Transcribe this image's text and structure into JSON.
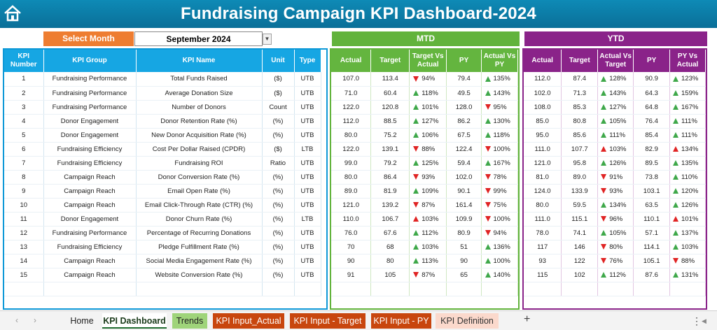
{
  "title": "Fundraising Campaign KPI Dashboard-2024",
  "select_month_label": "Select Month",
  "select_month_value": "September 2024",
  "mtd_label": "MTD",
  "ytd_label": "YTD",
  "kpi_headers": [
    "KPI Number",
    "KPI Group",
    "KPI Name",
    "Unit",
    "Type"
  ],
  "mtd_headers": [
    "Actual",
    "Target",
    "Target Vs Actual",
    "PY",
    "Actual Vs PY"
  ],
  "ytd_headers": [
    "Actual",
    "Target",
    "Actual Vs Target",
    "PY",
    "PY Vs Actual"
  ],
  "rows": [
    {
      "num": "1",
      "group": "Fundraising Performance",
      "name": "Total Funds Raised",
      "unit": "($)",
      "type": "UTB",
      "mtd": [
        "107.0",
        "113.4",
        "94%",
        "79.4",
        "135%"
      ],
      "mtd_ind": [
        "down",
        "up"
      ],
      "ytd": [
        "112.0",
        "87.4",
        "128%",
        "90.9",
        "123%"
      ],
      "ytd_ind": [
        "up",
        "up"
      ]
    },
    {
      "num": "2",
      "group": "Fundraising Performance",
      "name": "Average Donation Size",
      "unit": "($)",
      "type": "UTB",
      "mtd": [
        "71.0",
        "60.4",
        "118%",
        "49.5",
        "143%"
      ],
      "mtd_ind": [
        "up",
        "up"
      ],
      "ytd": [
        "102.0",
        "71.3",
        "143%",
        "64.3",
        "159%"
      ],
      "ytd_ind": [
        "up",
        "up"
      ]
    },
    {
      "num": "3",
      "group": "Fundraising Performance",
      "name": "Number of Donors",
      "unit": "Count",
      "type": "UTB",
      "mtd": [
        "122.0",
        "120.8",
        "101%",
        "128.0",
        "95%"
      ],
      "mtd_ind": [
        "up",
        "down"
      ],
      "ytd": [
        "108.0",
        "85.3",
        "127%",
        "64.8",
        "167%"
      ],
      "ytd_ind": [
        "up",
        "up"
      ]
    },
    {
      "num": "4",
      "group": "Donor Engagement",
      "name": "Donor Retention Rate (%)",
      "unit": "(%)",
      "type": "UTB",
      "mtd": [
        "112.0",
        "88.5",
        "127%",
        "86.2",
        "130%"
      ],
      "mtd_ind": [
        "up",
        "up"
      ],
      "ytd": [
        "85.0",
        "80.8",
        "105%",
        "76.4",
        "111%"
      ],
      "ytd_ind": [
        "up",
        "up"
      ]
    },
    {
      "num": "5",
      "group": "Donor Engagement",
      "name": "New Donor Acquisition Rate (%)",
      "unit": "(%)",
      "type": "UTB",
      "mtd": [
        "80.0",
        "75.2",
        "106%",
        "67.5",
        "118%"
      ],
      "mtd_ind": [
        "up",
        "up"
      ],
      "ytd": [
        "95.0",
        "85.6",
        "111%",
        "85.4",
        "111%"
      ],
      "ytd_ind": [
        "up",
        "up"
      ]
    },
    {
      "num": "6",
      "group": "Fundraising Efficiency",
      "name": "Cost Per Dollar Raised (CPDR)",
      "unit": "($)",
      "type": "LTB",
      "mtd": [
        "122.0",
        "139.1",
        "88%",
        "122.4",
        "100%"
      ],
      "mtd_ind": [
        "down",
        "down"
      ],
      "ytd": [
        "111.0",
        "107.7",
        "103%",
        "82.9",
        "134%"
      ],
      "ytd_ind": [
        "upred",
        "upred"
      ]
    },
    {
      "num": "7",
      "group": "Fundraising Efficiency",
      "name": "Fundraising ROI",
      "unit": "Ratio",
      "type": "UTB",
      "mtd": [
        "99.0",
        "79.2",
        "125%",
        "59.4",
        "167%"
      ],
      "mtd_ind": [
        "up",
        "up"
      ],
      "ytd": [
        "121.0",
        "95.8",
        "126%",
        "89.5",
        "135%"
      ],
      "ytd_ind": [
        "up",
        "up"
      ]
    },
    {
      "num": "8",
      "group": "Campaign Reach",
      "name": "Donor Conversion Rate (%)",
      "unit": "(%)",
      "type": "UTB",
      "mtd": [
        "80.0",
        "86.4",
        "93%",
        "102.0",
        "78%"
      ],
      "mtd_ind": [
        "down",
        "down"
      ],
      "ytd": [
        "81.0",
        "89.0",
        "91%",
        "73.8",
        "110%"
      ],
      "ytd_ind": [
        "down",
        "up"
      ]
    },
    {
      "num": "9",
      "group": "Campaign Reach",
      "name": "Email Open Rate (%)",
      "unit": "(%)",
      "type": "UTB",
      "mtd": [
        "89.0",
        "81.9",
        "109%",
        "90.1",
        "99%"
      ],
      "mtd_ind": [
        "up",
        "down"
      ],
      "ytd": [
        "124.0",
        "133.9",
        "93%",
        "103.1",
        "120%"
      ],
      "ytd_ind": [
        "down",
        "up"
      ]
    },
    {
      "num": "10",
      "group": "Campaign Reach",
      "name": "Email Click-Through Rate (CTR) (%)",
      "unit": "(%)",
      "type": "UTB",
      "mtd": [
        "121.0",
        "139.2",
        "87%",
        "161.4",
        "75%"
      ],
      "mtd_ind": [
        "down",
        "down"
      ],
      "ytd": [
        "80.0",
        "59.5",
        "134%",
        "63.5",
        "126%"
      ],
      "ytd_ind": [
        "up",
        "up"
      ]
    },
    {
      "num": "11",
      "group": "Donor Engagement",
      "name": "Donor Churn Rate (%)",
      "unit": "(%)",
      "type": "LTB",
      "mtd": [
        "110.0",
        "106.7",
        "103%",
        "109.9",
        "100%"
      ],
      "mtd_ind": [
        "upred",
        "down"
      ],
      "ytd": [
        "111.0",
        "115.1",
        "96%",
        "110.1",
        "101%"
      ],
      "ytd_ind": [
        "down",
        "upred"
      ]
    },
    {
      "num": "12",
      "group": "Fundraising Performance",
      "name": "Percentage of Recurring Donations",
      "unit": "(%)",
      "type": "UTB",
      "mtd": [
        "76.0",
        "67.6",
        "112%",
        "80.9",
        "94%"
      ],
      "mtd_ind": [
        "up",
        "down"
      ],
      "ytd": [
        "78.0",
        "74.1",
        "105%",
        "57.1",
        "137%"
      ],
      "ytd_ind": [
        "up",
        "up"
      ]
    },
    {
      "num": "13",
      "group": "Fundraising Efficiency",
      "name": "Pledge Fulfillment Rate (%)",
      "unit": "(%)",
      "type": "UTB",
      "mtd": [
        "70",
        "68",
        "103%",
        "51",
        "136%"
      ],
      "mtd_ind": [
        "up",
        "up"
      ],
      "ytd": [
        "117",
        "146",
        "80%",
        "114.1",
        "103%"
      ],
      "ytd_ind": [
        "down",
        "up"
      ]
    },
    {
      "num": "14",
      "group": "Campaign Reach",
      "name": "Social Media Engagement Rate (%)",
      "unit": "(%)",
      "type": "UTB",
      "mtd": [
        "90",
        "80",
        "113%",
        "90",
        "100%"
      ],
      "mtd_ind": [
        "up",
        "up"
      ],
      "ytd": [
        "93",
        "122",
        "76%",
        "105.1",
        "88%"
      ],
      "ytd_ind": [
        "down",
        "down"
      ]
    },
    {
      "num": "15",
      "group": "Campaign Reach",
      "name": "Website Conversion Rate (%)",
      "unit": "(%)",
      "type": "UTB",
      "mtd": [
        "91",
        "105",
        "87%",
        "65",
        "140%"
      ],
      "mtd_ind": [
        "down",
        "up"
      ],
      "ytd": [
        "115",
        "102",
        "112%",
        "87.6",
        "131%"
      ],
      "ytd_ind": [
        "up",
        "up"
      ]
    }
  ],
  "tabs": {
    "home": "Home",
    "dashboard": "KPI Dashboard",
    "trends": "Trends",
    "input_actual": "KPI Input_Actual",
    "input_target": "KPI Input - Target",
    "input_py": "KPI Input - PY",
    "definition": "KPI Definition"
  },
  "colors": {
    "title_bg": "#0e8ab6",
    "mtd": "#62b33c",
    "ytd": "#8a2389",
    "kpi": "#16a6e3",
    "select": "#ee7d31",
    "up": "#3fa84a",
    "down": "#e02424"
  }
}
